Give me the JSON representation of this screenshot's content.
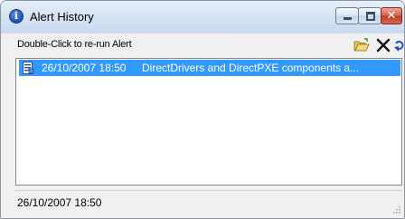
{
  "window": {
    "title": "Alert History",
    "controls": {
      "minimize": "minimize",
      "maximize": "maximize",
      "close": "✕"
    }
  },
  "toolbar": {
    "hint": "Double-Click to re-run Alert",
    "icons": [
      "open-folder-icon",
      "delete-icon",
      "rerun-icon"
    ]
  },
  "alerts": [
    {
      "date": "26/10/2007 18:50",
      "description": "DirectDrivers and DirectPXE components a...",
      "selected": true
    }
  ],
  "status": {
    "text": "26/10/2007 18:50"
  },
  "colors": {
    "selection": "#3399ff",
    "title_bar": "#d6e3f4",
    "close_button": "#c84a32"
  }
}
